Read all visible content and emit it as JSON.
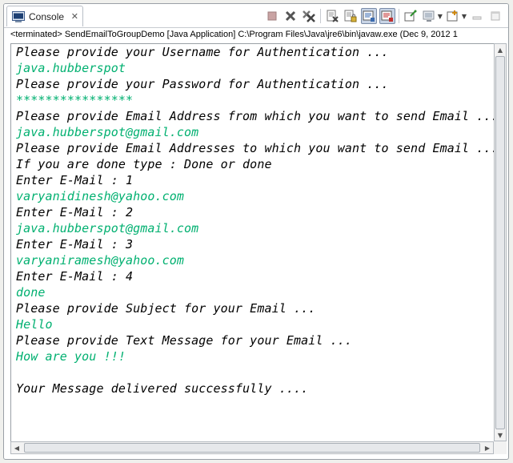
{
  "tab": {
    "label": "Console",
    "close_glyph": "✕"
  },
  "toolbar": {
    "buttons": [
      {
        "name": "terminate-icon"
      },
      {
        "name": "remove-launch-icon"
      },
      {
        "name": "remove-all-terminated-icon"
      },
      {
        "name": "clear-console-icon"
      },
      {
        "name": "scroll-lock-icon"
      },
      {
        "name": "show-on-stdout-icon"
      },
      {
        "name": "show-on-stderr-icon"
      },
      {
        "name": "pin-console-icon"
      },
      {
        "name": "display-selected-console-icon"
      },
      {
        "name": "open-console-icon"
      },
      {
        "name": "minimize-icon"
      },
      {
        "name": "maximize-icon"
      }
    ]
  },
  "status": "<terminated> SendEmailToGroupDemo [Java Application] C:\\Program Files\\Java\\jre6\\bin\\javaw.exe (Dec 9, 2012 1",
  "colors": {
    "output": "#000000",
    "input": "#00b070"
  },
  "console": {
    "lines": [
      {
        "type": "out",
        "text": "Please provide your Username for Authentication ..."
      },
      {
        "type": "in",
        "text": "java.hubberspot"
      },
      {
        "type": "out",
        "text": "Please provide your Password for Authentication ..."
      },
      {
        "type": "in",
        "text": "****************"
      },
      {
        "type": "out",
        "text": "Please provide Email Address from which you want to send Email ..."
      },
      {
        "type": "in",
        "text": "java.hubberspot@gmail.com"
      },
      {
        "type": "out",
        "text": "Please provide Email Addresses to which you want to send Email ..."
      },
      {
        "type": "out",
        "text": "If you are done type : Done or done"
      },
      {
        "type": "out",
        "text": "Enter E-Mail : 1"
      },
      {
        "type": "in",
        "text": "varyanidinesh@yahoo.com"
      },
      {
        "type": "out",
        "text": "Enter E-Mail : 2"
      },
      {
        "type": "in",
        "text": "java.hubberspot@gmail.com"
      },
      {
        "type": "out",
        "text": "Enter E-Mail : 3"
      },
      {
        "type": "in",
        "text": "varyaniramesh@yahoo.com"
      },
      {
        "type": "out",
        "text": "Enter E-Mail : 4"
      },
      {
        "type": "in",
        "text": "done"
      },
      {
        "type": "out",
        "text": "Please provide Subject for your Email ..."
      },
      {
        "type": "in",
        "text": "Hello"
      },
      {
        "type": "out",
        "text": "Please provide Text Message for your Email ..."
      },
      {
        "type": "in",
        "text": "How are you !!!"
      },
      {
        "type": "out",
        "text": ""
      },
      {
        "type": "out",
        "text": "Your Message delivered successfully ...."
      }
    ]
  },
  "scrollbar": {
    "up": "▲",
    "down": "▼",
    "left": "◀",
    "right": "▶"
  }
}
